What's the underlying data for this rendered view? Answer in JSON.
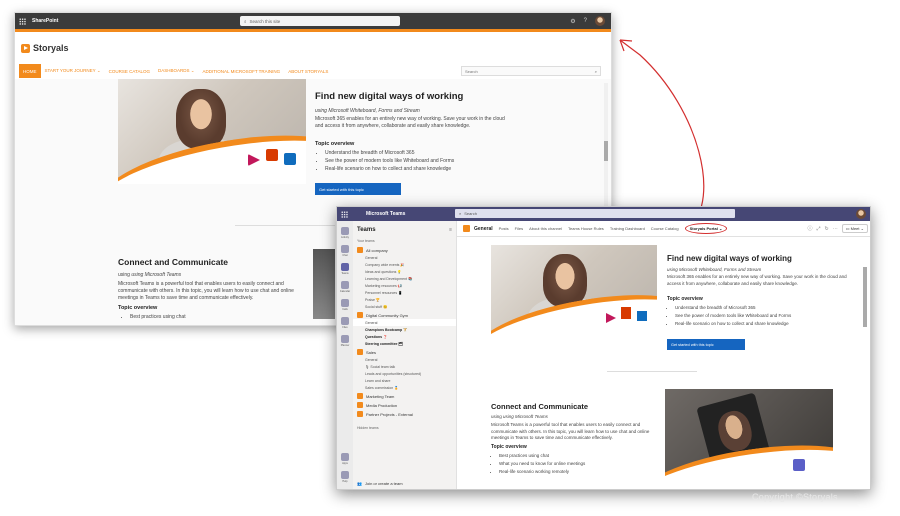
{
  "sharepoint": {
    "app_name": "SharePoint",
    "search_placeholder": "Search this site",
    "brand": "Storyals",
    "nav": [
      "HOME",
      "START YOUR JOURNEY ⌄",
      "COURSE CATALOG",
      "DASHBOARDS ⌄",
      "ADDITIONAL MICROSOFT TRAINING",
      "ABOUT STORYALS"
    ],
    "nav_search": "Search",
    "topic1": {
      "title": "Find new digital ways of working",
      "subtitle": "using Microsoft Whiteboard, Forms and Stream",
      "body": "Microsoft 365 enables for an entirely new way of working. Save your work in the cloud and access it from anywhere, collaborate and easily share knowledge.",
      "overview_title": "Topic overview",
      "bullets": [
        "Understand the breadth of Microsoft 365",
        "See the power of modern tools like Whiteboard and Forms",
        "Real-life scenario on how to collect and share knowledge"
      ],
      "button": "Get started with this topic"
    },
    "topic2": {
      "title": "Connect and Communicate",
      "subtitle": "using Microsoft Teams",
      "body": "Microsoft Teams is a powerful tool that enables users to easily connect and communicate with others. In this topic, you will learn how to use chat and online meetings in Teams to save time and communicate effectively.",
      "overview_title": "Topic overview",
      "bullets": [
        "Best practices using chat"
      ]
    }
  },
  "teams": {
    "app_name": "Microsoft Teams",
    "search_placeholder": "Search",
    "rail": [
      "Activity",
      "Chat",
      "Teams",
      "Calendar",
      "Calls",
      "Files",
      "Planner",
      "Apps",
      "Help"
    ],
    "sidebar_title": "Teams",
    "section_label": "Your teams",
    "teams_list": [
      {
        "name": "All company",
        "channels": [
          {
            "name": "General",
            "bold": false
          },
          {
            "name": "Company wide events 🎉",
            "bold": false
          },
          {
            "name": "Ideas and questions 💡",
            "bold": false
          },
          {
            "name": "Learning and Development 📚",
            "bold": false
          },
          {
            "name": "Marketing resources 📢",
            "bold": false
          },
          {
            "name": "Personnel resources 📱",
            "bold": false
          },
          {
            "name": "Praise 🏆",
            "bold": false
          },
          {
            "name": "Social stuff 😊",
            "bold": false
          }
        ]
      },
      {
        "name": "Digital Community Gym",
        "channels": [
          {
            "name": "General",
            "bold": false,
            "sel": true
          },
          {
            "name": "Champions Bootcamp 🏋",
            "bold": true
          },
          {
            "name": "Questions ❓",
            "bold": true
          },
          {
            "name": "Steering committee 🗂",
            "bold": true
          }
        ]
      },
      {
        "name": "Sales",
        "channels": [
          {
            "name": "General",
            "bold": false
          },
          {
            "name": "🎙 Social team talk",
            "bold": false
          },
          {
            "name": "Leads and opportunities (structured)",
            "bold": false
          },
          {
            "name": "Learn and share",
            "bold": false
          },
          {
            "name": "Sales commission 🏅",
            "bold": false
          }
        ]
      },
      {
        "name": "Marketing Team",
        "channels": []
      },
      {
        "name": "Media Production",
        "channels": []
      },
      {
        "name": "Partner Projects - External",
        "channels": []
      }
    ],
    "hidden_teams": "Hidden teams",
    "join_create": "Join or create a team",
    "channel_name": "General",
    "tabs": [
      "Posts",
      "Files",
      "About this channel",
      "Teams House Rules",
      "Training Dashboard",
      "Course Catalog",
      "Storyals Portal ⌄"
    ],
    "meet_label": "Meet",
    "topic1": {
      "title": "Find new digital ways of working",
      "subtitle": "using Microsoft Whiteboard, Forms and Stream",
      "body": "Microsoft 365 enables for an entirely new way of working. Save your work in the cloud and access it from anywhere, collaborate and easily share knowledge.",
      "overview_title": "Topic overview",
      "bullets": [
        "Understand the breadth of Microsoft 365",
        "See the power of modern tools like Whiteboard and Forms",
        "Real-life scenario on how to collect and share knowledge"
      ],
      "button": "Get started with this topic"
    },
    "topic2": {
      "title": "Connect and Communicate",
      "subtitle": "using Microsoft Teams",
      "body": "Microsoft Teams is a powerful tool that enables users to easily connect and communicate with others. In this topic, you will learn how to use chat and online meetings in Teams to save time and communicate effectively.",
      "overview_title": "Topic overview",
      "bullets": [
        "Best practices using chat",
        "What you need to know for online meetings",
        "Real-life scenario working remotely"
      ]
    }
  },
  "copyright": "Copyright ©Storyals",
  "colors": {
    "accent": "#f28a1c",
    "teams_purple": "#464775",
    "button_blue": "#1565c0",
    "highlight_red": "#d32f2f"
  }
}
